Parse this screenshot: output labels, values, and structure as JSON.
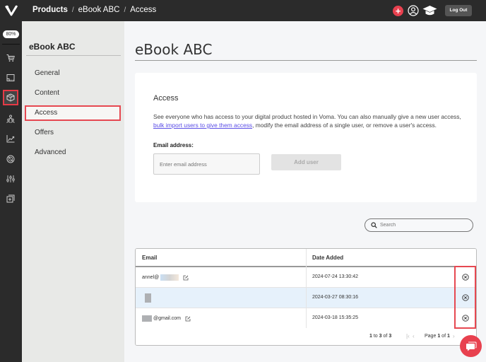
{
  "topbar": {
    "logo": "voma-logo-icon",
    "breadcrumb": [
      "Products",
      "eBook ABC",
      "Access"
    ],
    "separator": "/",
    "add_label": "+",
    "logout_label": "Log Out",
    "accent_color": "#e8414f"
  },
  "rail": {
    "zoom_label": "80%",
    "items": [
      {
        "icon": "cart-icon"
      },
      {
        "icon": "website-icon"
      },
      {
        "icon": "product-box-icon",
        "active": true
      },
      {
        "icon": "people-icon"
      },
      {
        "icon": "analytics-icon"
      },
      {
        "icon": "integrations-icon"
      },
      {
        "icon": "settings-sliders-icon"
      },
      {
        "icon": "apps-icon"
      }
    ]
  },
  "subnav": {
    "title": "eBook ABC",
    "items": [
      {
        "label": "General"
      },
      {
        "label": "Content"
      },
      {
        "label": "Access",
        "active": true
      },
      {
        "label": "Offers"
      },
      {
        "label": "Advanced"
      }
    ]
  },
  "page": {
    "title": "eBook ABC"
  },
  "access_card": {
    "title": "Access",
    "description_before": "See everyone who has access to your digital product hosted in Voma. You can also manually give a new user access, ",
    "description_link": "bulk import users to give them access",
    "description_after": ", modify the email address of a single user, or remove a user's access.",
    "email_label": "Email address:",
    "email_placeholder": "Enter email address",
    "email_value": "",
    "add_user_label": "Add user"
  },
  "search": {
    "placeholder": "Search",
    "value": ""
  },
  "table": {
    "columns": [
      "Email",
      "Date Added"
    ],
    "rows": [
      {
        "email_prefix": "annel@",
        "email_suffix": "",
        "date": "2024-07-24 13:30:42",
        "highlighted": false
      },
      {
        "email_prefix": "",
        "email_suffix": "",
        "date": "2024-03-27 08:30:16",
        "highlighted": true
      },
      {
        "email_prefix": "",
        "email_suffix": "@gmail.com",
        "date": "2024-03-18 15:35:25",
        "highlighted": false
      }
    ],
    "pager": {
      "count_from": "1",
      "count_to_word": "to",
      "count_to": "3",
      "count_of_word": "of",
      "count_total": "3",
      "page_word": "Page",
      "page": "1",
      "of_word": "of",
      "pages": "1"
    }
  }
}
